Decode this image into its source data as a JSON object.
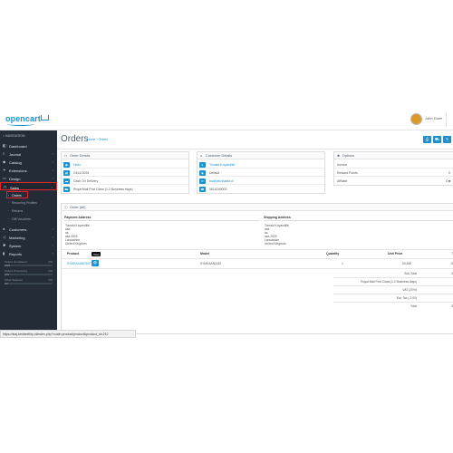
{
  "header": {
    "logo": "opencart",
    "user_name": "John Doe",
    "user_caret": "▾"
  },
  "sidebar": {
    "title": "NAVIGATION",
    "items": [
      {
        "icon": "dashboard-icon",
        "glyph": "◧",
        "label": "Dashboard",
        "arrow": ""
      },
      {
        "icon": "journal-icon",
        "glyph": "≡",
        "label": "Journal",
        "arrow": "›"
      },
      {
        "icon": "tag-icon",
        "glyph": "◆",
        "label": "Catalog",
        "arrow": "›"
      },
      {
        "icon": "puzzle-icon",
        "glyph": "✦",
        "label": "Extensions",
        "arrow": "›"
      },
      {
        "icon": "desktop-icon",
        "glyph": "▭",
        "label": "Design",
        "arrow": "›"
      },
      {
        "icon": "cart-icon",
        "glyph": "⊓",
        "label": "Sales",
        "arrow": "›"
      }
    ],
    "sales_sub": [
      {
        "label": "Orders"
      },
      {
        "label": "Recurring Profiles"
      },
      {
        "label": "Returns"
      },
      {
        "label": "Gift Vouchers"
      }
    ],
    "items_lower": [
      {
        "icon": "user-icon",
        "glyph": "●",
        "label": "Customers",
        "arrow": "›"
      },
      {
        "icon": "share-icon",
        "glyph": "◁",
        "label": "Marketing",
        "arrow": "›"
      },
      {
        "icon": "cog-icon",
        "glyph": "✱",
        "label": "System",
        "arrow": "›"
      },
      {
        "icon": "bar-chart-icon",
        "glyph": "▮",
        "label": "Reports",
        "arrow": "›"
      }
    ],
    "progress": [
      {
        "label": "Orders Completed",
        "percent": "0%",
        "fill": 0.12
      },
      {
        "label": "Orders Processing",
        "percent": "0%",
        "fill": 0.1
      },
      {
        "label": "Other Statuses",
        "percent": "0%",
        "fill": 0.08
      }
    ]
  },
  "main": {
    "title": "Orders",
    "breadcrumb_home": "Home",
    "breadcrumb_sep": "›",
    "breadcrumb_current": "Orders",
    "toolbar": [
      {
        "name": "print-invoice-button",
        "glyph": "⎙"
      },
      {
        "name": "print-shipping-button",
        "glyph": "⛟"
      },
      {
        "name": "edit-button",
        "glyph": "✎"
      }
    ],
    "order_details": {
      "title": "Order Details",
      "rows": [
        {
          "icon": "store-icon",
          "glyph": "▣",
          "text": "Hello",
          "link": true
        },
        {
          "icon": "calendar-icon",
          "glyph": "▦",
          "text": "24/11/2025",
          "link": false
        },
        {
          "icon": "credit-card-icon",
          "glyph": "▬",
          "text": "Cash On Delivery",
          "link": false
        },
        {
          "icon": "truck-icon",
          "glyph": "⛟",
          "text": "Royal Mail First Class (1.2 Business days)",
          "link": false
        }
      ]
    },
    "customer_details": {
      "title": "Customer Details",
      "rows": [
        {
          "icon": "user-icon",
          "glyph": "●",
          "text": "Tomald Koyandillé",
          "link": true
        },
        {
          "icon": "group-icon",
          "glyph": "◉",
          "text": "Default",
          "link": false
        },
        {
          "icon": "envelope-icon",
          "glyph": "✉",
          "text": "tsa@abcblabla.nl",
          "link": true
        },
        {
          "icon": "phone-icon",
          "glyph": "☎",
          "text": "0616249003",
          "link": false
        }
      ]
    },
    "options": {
      "title": "Options",
      "rows": [
        {
          "label": "Invoice",
          "value": ""
        },
        {
          "label": "Reward Points",
          "value": "0"
        },
        {
          "label": "Affiliate",
          "value": "0 ■"
        }
      ]
    },
    "order_panel": {
      "title": "Order (#6)",
      "payment_head": "Payment Address",
      "shipping_head": "Shipping Address",
      "payment_lines": [
        "Tomald Koyandillé",
        "asa",
        "as",
        "asa 2525",
        "Lancashire",
        "United Kingdom"
      ],
      "shipping_lines": [
        "Tomald Koyandillé",
        "asa",
        "as",
        "asa 2525",
        "Lancashire",
        "United Kingdom"
      ],
      "table_head": {
        "product": "Product",
        "model": "Model",
        "quantity": "Quantity",
        "unit_price": "Unit Price",
        "total": "T"
      },
      "rows": [
        {
          "product": "SYMKAAANO5XT",
          "model": "SYMKAAN0451",
          "quantity": "1",
          "unit_price": "50,52€",
          "total": "50"
        }
      ],
      "tooltip": "View",
      "view_glyph": "👁",
      "totals": [
        {
          "label": "Sub-Total",
          "value": "40"
        },
        {
          "label": "Royal Mail First Class (1.2 Business days)",
          "value": "3"
        },
        {
          "label": "VAT (20%)",
          "value": "9"
        },
        {
          "label": "Eco Tax (-2.00)",
          "value": "2"
        },
        {
          "label": "Total",
          "value": "55"
        }
      ]
    }
  },
  "status_url": "https://staj.bimbeethty.nl/index.php?route=product/product&product_id=212"
}
